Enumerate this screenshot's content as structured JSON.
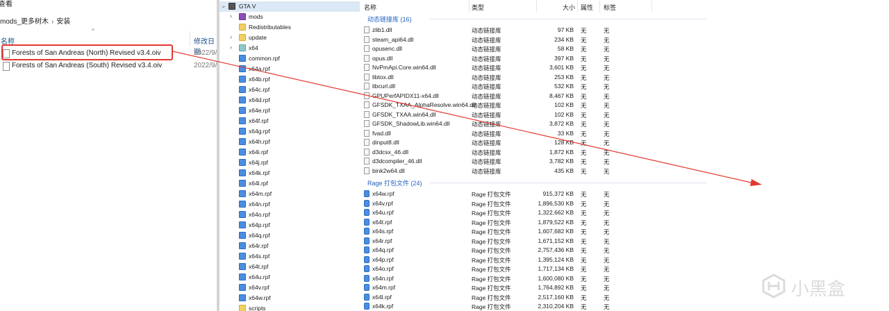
{
  "left_explorer": {
    "menu_label": "查看",
    "breadcrumb": [
      "mods_更多树木",
      "安装"
    ],
    "columns": {
      "name": "名称",
      "date": "修改日期"
    },
    "files": [
      {
        "name": "Forests of San Andreas (North) Revised v3.4.oiv",
        "date": "2022/9/",
        "highlighted": true
      },
      {
        "name": "Forests of San Andreas (South) Revised v3.4.oiv",
        "date": "2022/9/",
        "highlighted": false
      }
    ]
  },
  "tree": {
    "root": "GTA V",
    "items": [
      {
        "label": "mods",
        "icon": "mods-folder-icon",
        "expandable": true
      },
      {
        "label": "Redistributables",
        "icon": "folder-icon",
        "expandable": false
      },
      {
        "label": "update",
        "icon": "folder-icon",
        "expandable": true
      },
      {
        "label": "x64",
        "icon": "x64-folder-icon",
        "expandable": true
      },
      {
        "label": "common.rpf",
        "icon": "rpf-icon",
        "expandable": false
      },
      {
        "label": "x64a.rpf",
        "icon": "rpf-icon",
        "expandable": false
      },
      {
        "label": "x64b.rpf",
        "icon": "rpf-icon",
        "expandable": false
      },
      {
        "label": "x64c.rpf",
        "icon": "rpf-icon",
        "expandable": false
      },
      {
        "label": "x64d.rpf",
        "icon": "rpf-icon",
        "expandable": false
      },
      {
        "label": "x64e.rpf",
        "icon": "rpf-icon",
        "expandable": false
      },
      {
        "label": "x64f.rpf",
        "icon": "rpf-icon",
        "expandable": false
      },
      {
        "label": "x64g.rpf",
        "icon": "rpf-icon",
        "expandable": false
      },
      {
        "label": "x64h.rpf",
        "icon": "rpf-icon",
        "expandable": false
      },
      {
        "label": "x64i.rpf",
        "icon": "rpf-icon",
        "expandable": false
      },
      {
        "label": "x64j.rpf",
        "icon": "rpf-icon",
        "expandable": false
      },
      {
        "label": "x64k.rpf",
        "icon": "rpf-icon",
        "expandable": false
      },
      {
        "label": "x64l.rpf",
        "icon": "rpf-icon",
        "expandable": false
      },
      {
        "label": "x64m.rpf",
        "icon": "rpf-icon",
        "expandable": false
      },
      {
        "label": "x64n.rpf",
        "icon": "rpf-icon",
        "expandable": false
      },
      {
        "label": "x64o.rpf",
        "icon": "rpf-icon",
        "expandable": false
      },
      {
        "label": "x64p.rpf",
        "icon": "rpf-icon",
        "expandable": false
      },
      {
        "label": "x64q.rpf",
        "icon": "rpf-icon",
        "expandable": false
      },
      {
        "label": "x64r.rpf",
        "icon": "rpf-icon",
        "expandable": false
      },
      {
        "label": "x64s.rpf",
        "icon": "rpf-icon",
        "expandable": false
      },
      {
        "label": "x64t.rpf",
        "icon": "rpf-icon",
        "expandable": false
      },
      {
        "label": "x64u.rpf",
        "icon": "rpf-icon",
        "expandable": false
      },
      {
        "label": "x64v.rpf",
        "icon": "rpf-icon",
        "expandable": false
      },
      {
        "label": "x64w.rpf",
        "icon": "rpf-icon",
        "expandable": false
      },
      {
        "label": "scripts",
        "icon": "folder-icon",
        "expandable": false
      }
    ]
  },
  "detail": {
    "columns": {
      "name": "名称",
      "type": "类型",
      "size": "大小",
      "attr": "属性",
      "tag": "标签"
    },
    "groups": [
      {
        "label": "动态链接库 (16)",
        "icon": "dll-file-icon",
        "rows": [
          {
            "name": "zlib1.dll",
            "type": "动态链接库",
            "size": "97 KB",
            "attr": "无",
            "tag": "无"
          },
          {
            "name": "steam_api64.dll",
            "type": "动态链接库",
            "size": "234 KB",
            "attr": "无",
            "tag": "无"
          },
          {
            "name": "opusenc.dll",
            "type": "动态链接库",
            "size": "58 KB",
            "attr": "无",
            "tag": "无"
          },
          {
            "name": "opus.dll",
            "type": "动态链接库",
            "size": "397 KB",
            "attr": "无",
            "tag": "无"
          },
          {
            "name": "NvPmApi.Core.win64.dll",
            "type": "动态链接库",
            "size": "3,601 KB",
            "attr": "无",
            "tag": "无"
          },
          {
            "name": "libtox.dll",
            "type": "动态链接库",
            "size": "253 KB",
            "attr": "无",
            "tag": "无"
          },
          {
            "name": "libcurl.dll",
            "type": "动态链接库",
            "size": "532 KB",
            "attr": "无",
            "tag": "无"
          },
          {
            "name": "GPUPerfAPIDX11-x64.dll",
            "type": "动态链接库",
            "size": "8,467 KB",
            "attr": "无",
            "tag": "无"
          },
          {
            "name": "GFSDK_TXAA_AlphaResolve.win64.dll",
            "type": "动态链接库",
            "size": "102 KB",
            "attr": "无",
            "tag": "无"
          },
          {
            "name": "GFSDK_TXAA.win64.dll",
            "type": "动态链接库",
            "size": "102 KB",
            "attr": "无",
            "tag": "无"
          },
          {
            "name": "GFSDK_ShadowLib.win64.dll",
            "type": "动态链接库",
            "size": "3,872 KB",
            "attr": "无",
            "tag": "无"
          },
          {
            "name": "fvad.dll",
            "type": "动态链接库",
            "size": "33 KB",
            "attr": "无",
            "tag": "无"
          },
          {
            "name": "dinput8.dll",
            "type": "动态链接库",
            "size": "128 KB",
            "attr": "无",
            "tag": "无"
          },
          {
            "name": "d3dcsx_46.dll",
            "type": "动态链接库",
            "size": "1,872 KB",
            "attr": "无",
            "tag": "无"
          },
          {
            "name": "d3dcompiler_46.dll",
            "type": "动态链接库",
            "size": "3,782 KB",
            "attr": "无",
            "tag": "无"
          },
          {
            "name": "bink2w64.dll",
            "type": "动态链接库",
            "size": "435 KB",
            "attr": "无",
            "tag": "无"
          }
        ]
      },
      {
        "label": "Rage 打包文件 (24)",
        "icon": "rpf-file-icon",
        "rows": [
          {
            "name": "x64w.rpf",
            "type": "Rage 打包文件",
            "size": "915,372 KB",
            "attr": "无",
            "tag": "无"
          },
          {
            "name": "x64v.rpf",
            "type": "Rage 打包文件",
            "size": "1,896,530 KB",
            "attr": "无",
            "tag": "无"
          },
          {
            "name": "x64u.rpf",
            "type": "Rage 打包文件",
            "size": "1,322,662 KB",
            "attr": "无",
            "tag": "无"
          },
          {
            "name": "x64t.rpf",
            "type": "Rage 打包文件",
            "size": "1,879,522 KB",
            "attr": "无",
            "tag": "无"
          },
          {
            "name": "x64s.rpf",
            "type": "Rage 打包文件",
            "size": "1,607,682 KB",
            "attr": "无",
            "tag": "无"
          },
          {
            "name": "x64r.rpf",
            "type": "Rage 打包文件",
            "size": "1,671,152 KB",
            "attr": "无",
            "tag": "无"
          },
          {
            "name": "x64q.rpf",
            "type": "Rage 打包文件",
            "size": "2,757,436 KB",
            "attr": "无",
            "tag": "无"
          },
          {
            "name": "x64p.rpf",
            "type": "Rage 打包文件",
            "size": "1,395,124 KB",
            "attr": "无",
            "tag": "无"
          },
          {
            "name": "x64o.rpf",
            "type": "Rage 打包文件",
            "size": "1,717,134 KB",
            "attr": "无",
            "tag": "无"
          },
          {
            "name": "x64n.rpf",
            "type": "Rage 打包文件",
            "size": "1,600,080 KB",
            "attr": "无",
            "tag": "无"
          },
          {
            "name": "x64m.rpf",
            "type": "Rage 打包文件",
            "size": "1,764,892 KB",
            "attr": "无",
            "tag": "无"
          },
          {
            "name": "x64l.rpf",
            "type": "Rage 打包文件",
            "size": "2,517,160 KB",
            "attr": "无",
            "tag": "无"
          },
          {
            "name": "x64k.rpf",
            "type": "Rage 打包文件",
            "size": "2,310,204 KB",
            "attr": "无",
            "tag": "无"
          }
        ]
      }
    ]
  },
  "annotation": {
    "color": "#e2382e"
  },
  "watermark": {
    "text": "小黑盒"
  }
}
